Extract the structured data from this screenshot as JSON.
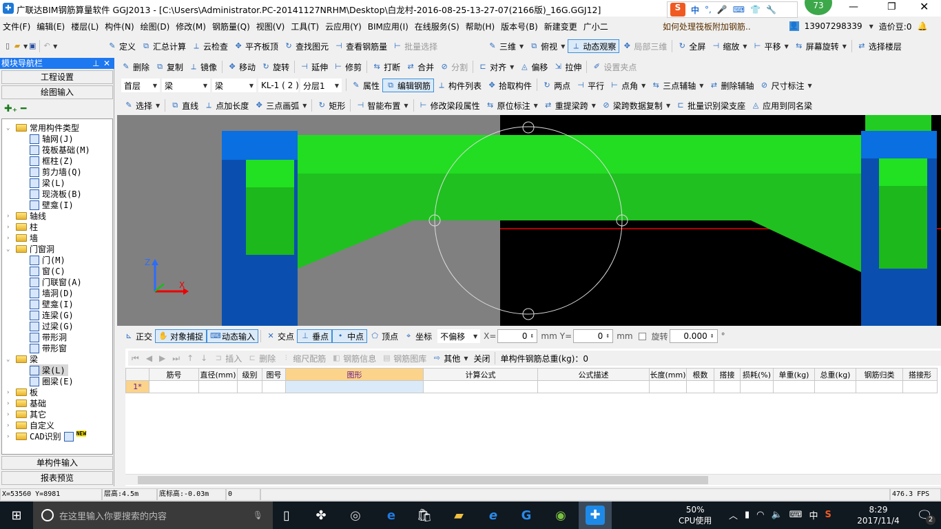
{
  "window": {
    "title": "广联达BIM钢筋算量软件 GGJ2013 - [C:\\Users\\Administrator.PC-20141127NRHM\\Desktop\\白龙村-2016-08-25-13-27-07(2166版)_16G.GGJ12]",
    "badge": "73",
    "ime": "中"
  },
  "menu": [
    "文件(F)",
    "编辑(E)",
    "楼层(L)",
    "构件(N)",
    "绘图(D)",
    "修改(M)",
    "钢筋量(Q)",
    "视图(V)",
    "工具(T)",
    "云应用(Y)",
    "BIM应用(I)",
    "在线服务(S)",
    "帮助(H)",
    "版本号(B)",
    "新建变更",
    "广小二"
  ],
  "menu_right": {
    "question": "如何处理筏板附加钢筋..",
    "account": "13907298339",
    "beans": "造价豆:0"
  },
  "toolbar1": {
    "left": [
      "定义",
      "汇总计算",
      "云检查",
      "平齐板顶",
      "查找图元",
      "查看钢筋量",
      "批量选择"
    ],
    "right": [
      "三维",
      "俯视",
      "动态观察",
      "局部三维",
      "全屏",
      "缩放",
      "平移",
      "屏幕旋转",
      "选择楼层"
    ]
  },
  "toolbar2": [
    "删除",
    "复制",
    "镜像",
    "移动",
    "旋转",
    "延伸",
    "修剪",
    "打断",
    "合并",
    "分割",
    "对齐",
    "偏移",
    "拉伸",
    "设置夹点"
  ],
  "toolbar3": {
    "combos": [
      "首层",
      "梁",
      "梁",
      "KL-1 ( 2 )",
      "分层1"
    ],
    "buttons": [
      "属性",
      "编辑钢筋",
      "构件列表",
      "拾取构件",
      "两点",
      "平行",
      "点角",
      "三点辅轴",
      "删除辅轴",
      "尺寸标注"
    ]
  },
  "toolbar4": [
    "选择",
    "直线",
    "点加长度",
    "三点画弧",
    "矩形",
    "智能布置",
    "修改梁段属性",
    "原位标注",
    "重提梁跨",
    "梁跨数据复制",
    "批量识别梁支座",
    "应用到同名梁"
  ],
  "sidebar": {
    "title": "模块导航栏",
    "top_buttons": [
      "工程设置",
      "绘图输入"
    ],
    "bottom_buttons": [
      "单构件输入",
      "报表预览"
    ],
    "tree": [
      {
        "label": "常用构件类型",
        "level": 0,
        "type": "folder",
        "open": true
      },
      {
        "label": "轴网(J)",
        "level": 1
      },
      {
        "label": "筏板基础(M)",
        "level": 1
      },
      {
        "label": "框柱(Z)",
        "level": 1
      },
      {
        "label": "剪力墙(Q)",
        "level": 1
      },
      {
        "label": "梁(L)",
        "level": 1
      },
      {
        "label": "现浇板(B)",
        "level": 1
      },
      {
        "label": "壁龛(I)",
        "level": 1
      },
      {
        "label": "轴线",
        "level": 0,
        "type": "folder"
      },
      {
        "label": "柱",
        "level": 0,
        "type": "folder"
      },
      {
        "label": "墙",
        "level": 0,
        "type": "folder"
      },
      {
        "label": "门窗洞",
        "level": 0,
        "type": "folder",
        "open": true
      },
      {
        "label": "门(M)",
        "level": 1
      },
      {
        "label": "窗(C)",
        "level": 1
      },
      {
        "label": "门联窗(A)",
        "level": 1
      },
      {
        "label": "墙洞(D)",
        "level": 1
      },
      {
        "label": "壁龛(I)",
        "level": 1
      },
      {
        "label": "连梁(G)",
        "level": 1
      },
      {
        "label": "过梁(G)",
        "level": 1
      },
      {
        "label": "带形洞",
        "level": 1
      },
      {
        "label": "带形窗",
        "level": 1
      },
      {
        "label": "梁",
        "level": 0,
        "type": "folder",
        "open": true
      },
      {
        "label": "梁(L)",
        "level": 1,
        "selected": true
      },
      {
        "label": "圈梁(E)",
        "level": 1
      },
      {
        "label": "板",
        "level": 0,
        "type": "folder"
      },
      {
        "label": "基础",
        "level": 0,
        "type": "folder"
      },
      {
        "label": "其它",
        "level": 0,
        "type": "folder"
      },
      {
        "label": "自定义",
        "level": 0,
        "type": "folder"
      },
      {
        "label": "CAD识别",
        "level": 0,
        "type": "folder",
        "new": "NEW"
      }
    ]
  },
  "snapbar": {
    "buttons": [
      "正交",
      "对象捕捉",
      "动态输入",
      "交点",
      "垂点",
      "中点",
      "顶点",
      "坐标"
    ],
    "offset": "不偏移",
    "x_label": "X=",
    "x": "0",
    "y_label": "Y=",
    "y": "0",
    "unit": "mm",
    "rotate_label": "旋转",
    "rotate": "0.000",
    "deg": "°"
  },
  "rebar": {
    "toolbar": [
      "插入",
      "删除",
      "缩尺配筋",
      "钢筋信息",
      "钢筋图库",
      "其他",
      "关闭"
    ],
    "total": "单构件钢筋总重(kg)：0",
    "columns": [
      "",
      "筋号",
      "直径(mm)",
      "级别",
      "图号",
      "图形",
      "计算公式",
      "公式描述",
      "长度(mm)",
      "根数",
      "搭接",
      "损耗(%)",
      "单重(kg)",
      "总重(kg)",
      "钢筋归类",
      "搭接形"
    ],
    "rows": [
      [
        "1*",
        "",
        "",
        "",
        "",
        "",
        "",
        "",
        "",
        "",
        "",
        "",
        "",
        "",
        "",
        ""
      ]
    ]
  },
  "statusbar": {
    "coords": "X=53560 Y=8981",
    "floor_height": "层高:4.5m",
    "base_elev": "底标高:-0.03m",
    "value": "0",
    "fps": "476.3 FPS"
  },
  "taskbar": {
    "search": "在这里输入你要搜索的内容",
    "cpu": "50%",
    "cpu_label": "CPU使用",
    "ime": "中",
    "time": "8:29",
    "date": "2017/11/4",
    "notifications": "2"
  }
}
